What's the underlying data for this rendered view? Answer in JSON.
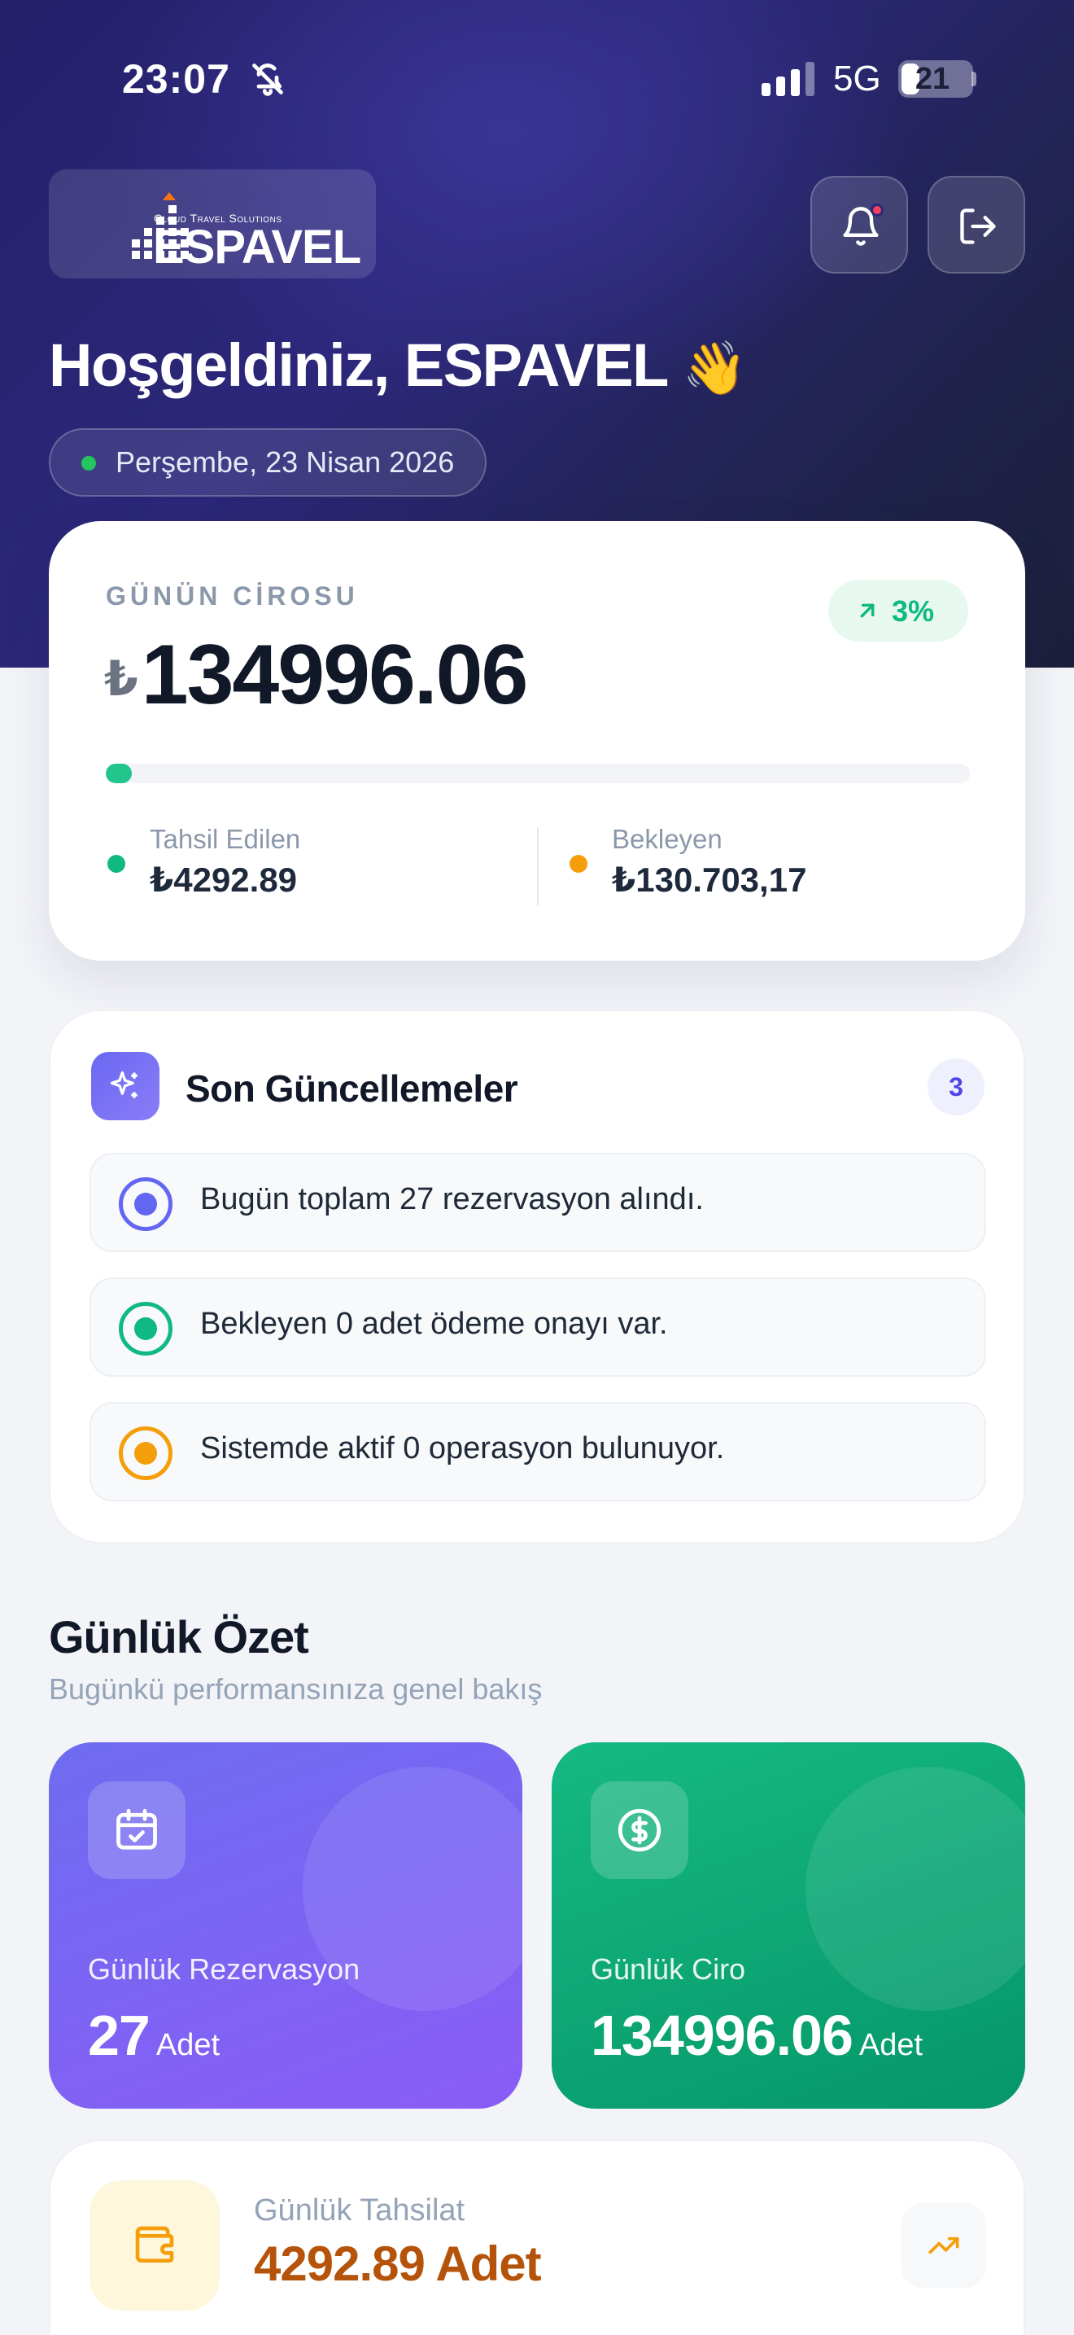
{
  "status_bar": {
    "time": "23:07",
    "network": "5G",
    "battery": "21"
  },
  "header": {
    "logo": {
      "tagline": "Cloud Travel Solutions",
      "wordmark": "ESPAVEL"
    },
    "welcome": "Hoşgeldiniz, ESPAVEL",
    "welcome_emoji": "👋",
    "date": "Perşembe, 23 Nisan 2026",
    "icons": [
      "bell-icon",
      "logout-icon"
    ]
  },
  "revenue_card": {
    "label": "GÜNÜN CİROSU",
    "trend": "3%",
    "currency_symbol": "₺",
    "amount": "134996.06",
    "progress_fraction": 0.03,
    "collected_label": "Tahsil Edilen",
    "collected_value": "₺4292.89",
    "pending_label": "Bekleyen",
    "pending_value": "₺130.703,17",
    "colors": {
      "collected": "#10b981",
      "pending": "#f59e0b"
    }
  },
  "updates": {
    "title": "Son Güncellemeler",
    "count": "3",
    "items": [
      {
        "text": "Bugün toplam 27 rezervasyon alındı.",
        "color": "#6366f1"
      },
      {
        "text": "Bekleyen 0 adet ödeme onayı var.",
        "color": "#10b981"
      },
      {
        "text": "Sistemde aktif 0 operasyon bulunuyor.",
        "color": "#f59e0b"
      }
    ]
  },
  "summary": {
    "title": "Günlük Özet",
    "subtitle": "Bugünkü performansınıza genel bakış",
    "reservation": {
      "label": "Günlük Rezervasyon",
      "value": "27",
      "unit": "Adet",
      "icon": "calendar-check-icon"
    },
    "revenue": {
      "label": "Günlük Ciro",
      "value": "134996.06",
      "unit": "Adet",
      "icon": "dollar-circle-icon"
    },
    "collection": {
      "label": "Günlük Tahsilat",
      "value": "4292.89 Adet",
      "icon": "wallet-icon"
    }
  }
}
